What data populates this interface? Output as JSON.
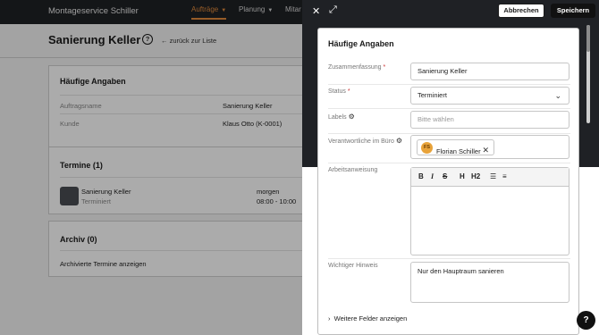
{
  "app": {
    "brand": "Montageservice Schiller",
    "nav": [
      {
        "label": "Aufträge",
        "active": true
      },
      {
        "label": "Planung",
        "active": false
      },
      {
        "label": "Mitar",
        "active": false
      }
    ]
  },
  "page": {
    "title": "Sanierung Keller",
    "help_glyph": "?",
    "back_link": "zurück zur Liste"
  },
  "cards": {
    "details": {
      "title": "Häufige Angaben",
      "rows": [
        {
          "label": "Auftragsname",
          "value": "Sanierung Keller"
        },
        {
          "label": "Kunde",
          "value": "Klaus Otto (K-0001)"
        }
      ]
    },
    "appointments": {
      "title": "Termine (1)",
      "item": {
        "name": "Sanierung Keller",
        "status": "Terminiert",
        "date": "morgen",
        "time": "08:00 - 10:00"
      }
    },
    "archive": {
      "title": "Archiv (0)",
      "link": "Archivierte Termine anzeigen"
    }
  },
  "drawer": {
    "close_glyph": "✕",
    "expand_glyph": "⤢",
    "cancel_label": "Abbrechen",
    "save_label": "Speichern",
    "form": {
      "title": "Häufige Angaben",
      "fields": {
        "summary": {
          "label": "Zusammenfassung",
          "required_mark": "*",
          "value": "Sanierung Keller"
        },
        "status": {
          "label": "Status",
          "required_mark": "*",
          "value": "Terminiert"
        },
        "labels": {
          "label": "Labels",
          "placeholder": "Bitte wählen"
        },
        "responsible": {
          "label": "Verantwortliche im Büro",
          "chip_initials": "FS",
          "chip_name": "Florian Schiller"
        },
        "instructions": {
          "label": "Arbeitsanweisung",
          "value": ""
        },
        "notice": {
          "label": "Wichtiger Hinweis",
          "value": "Nur den Hauptraum sanieren"
        }
      },
      "toolbar": [
        "B",
        "I",
        "S",
        "H",
        "H2",
        "bulleted-list",
        "numbered-list"
      ],
      "more_fields": "Weitere Felder anzeigen"
    }
  },
  "help_fab": "?",
  "colors": {
    "topbar": "#1f2125",
    "accent": "#e08a3c",
    "avatar": "#e8a33a",
    "primary_button": "#111111"
  }
}
